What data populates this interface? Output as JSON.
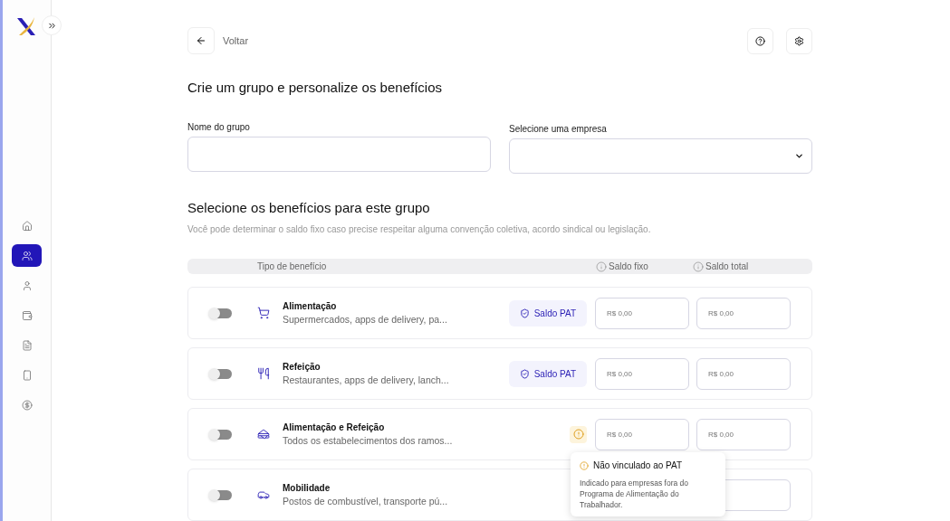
{
  "sidebar": {
    "items": [
      {
        "selected": false
      },
      {
        "selected": true
      },
      {
        "selected": false
      },
      {
        "selected": false
      },
      {
        "selected": false
      },
      {
        "selected": false
      },
      {
        "selected": false
      }
    ]
  },
  "header": {
    "back_label": "Voltar"
  },
  "title": "Crie um grupo e personalize os benefícios",
  "form": {
    "name_label": "Nome do grupo",
    "company_label": "Selecione uma empresa"
  },
  "benefits_title": "Selecione os benefícios para este grupo",
  "benefits_subtitle": "Você pode determinar o saldo fixo caso precise respeitar alguma convenção coletiva, acordo sindical ou legislação.",
  "table": {
    "columns": [
      "Tipo de benefício",
      "Saldo fixo",
      "Saldo total"
    ],
    "rows": [
      {
        "name": "Alimentação",
        "description": "Supermercados, apps de delivery, pa...",
        "on": false,
        "badge": {
          "kind": "pat",
          "label": "Saldo PAT"
        },
        "fixed_placeholder": "R$ 0,00",
        "total_placeholder": "R$ 0,00"
      },
      {
        "name": "Refeição",
        "description": "Restaurantes, apps de delivery, lanch...",
        "on": false,
        "badge": {
          "kind": "pat",
          "label": "Saldo PAT"
        },
        "fixed_placeholder": "R$ 0,00",
        "total_placeholder": "R$ 0,00"
      },
      {
        "name": "Alimentação e Refeição",
        "description": "Todos os estabelecimentos dos ramos...",
        "on": false,
        "badge": {
          "kind": "warning"
        },
        "fixed_placeholder": "R$ 0,00",
        "total_placeholder": "R$ 0,00"
      },
      {
        "name": "Mobilidade",
        "description": "Postos de combustível, transporte pú...",
        "on": false
      }
    ]
  },
  "tooltip": {
    "title": "Não vinculado ao PAT",
    "text": "Indicado para empresas fora do Programa de Alimentação do Trabalhador."
  }
}
